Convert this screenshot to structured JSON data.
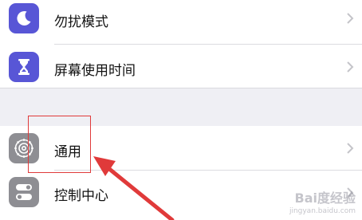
{
  "settings": {
    "items": [
      {
        "label": "勿扰模式",
        "icon": "moon-icon",
        "color": "#5856d6"
      },
      {
        "label": "屏幕使用时间",
        "icon": "hourglass-icon",
        "color": "#5856d6"
      },
      {
        "label": "通用",
        "icon": "gear-icon",
        "color": "#8e8e93"
      },
      {
        "label": "控制中心",
        "icon": "toggle-icon",
        "color": "#8e8e93"
      }
    ]
  },
  "annotation": {
    "highlight_color": "#e03a3a",
    "arrow_color": "#e03a3a"
  },
  "watermark": {
    "main": "Bai度经验",
    "sub": "jingyan.baidu.com"
  }
}
